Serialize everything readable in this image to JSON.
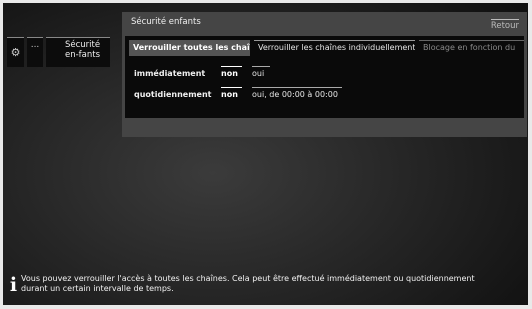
{
  "sidebar": {
    "icons": {
      "settings": "gear-icon",
      "more": "more-icon"
    },
    "more_label": "...",
    "item_label": "Sécurité en-fants"
  },
  "panel": {
    "title": "Sécurité enfants",
    "back_label": "Retour",
    "tabs": [
      {
        "label": "Verrouiller toutes les chaînes",
        "state": "active"
      },
      {
        "label": "Verrouiller les chaînes individuellement",
        "state": "normal"
      },
      {
        "label": "Blocage en fonction du",
        "state": "dim"
      }
    ],
    "rows": [
      {
        "label": "immédiatement",
        "no": "non",
        "yes": "oui",
        "selected": "no"
      },
      {
        "label": "quotidiennement",
        "no": "non",
        "yes": "oui, de 00:00 à 00:00",
        "selected": "no"
      }
    ]
  },
  "info": {
    "icon": "info-icon",
    "text": "Vous pouvez verrouiller l'accès à toutes les chaînes. Cela peut être effectué immédiatement ou quotidiennement durant un certain intervalle de temps."
  }
}
